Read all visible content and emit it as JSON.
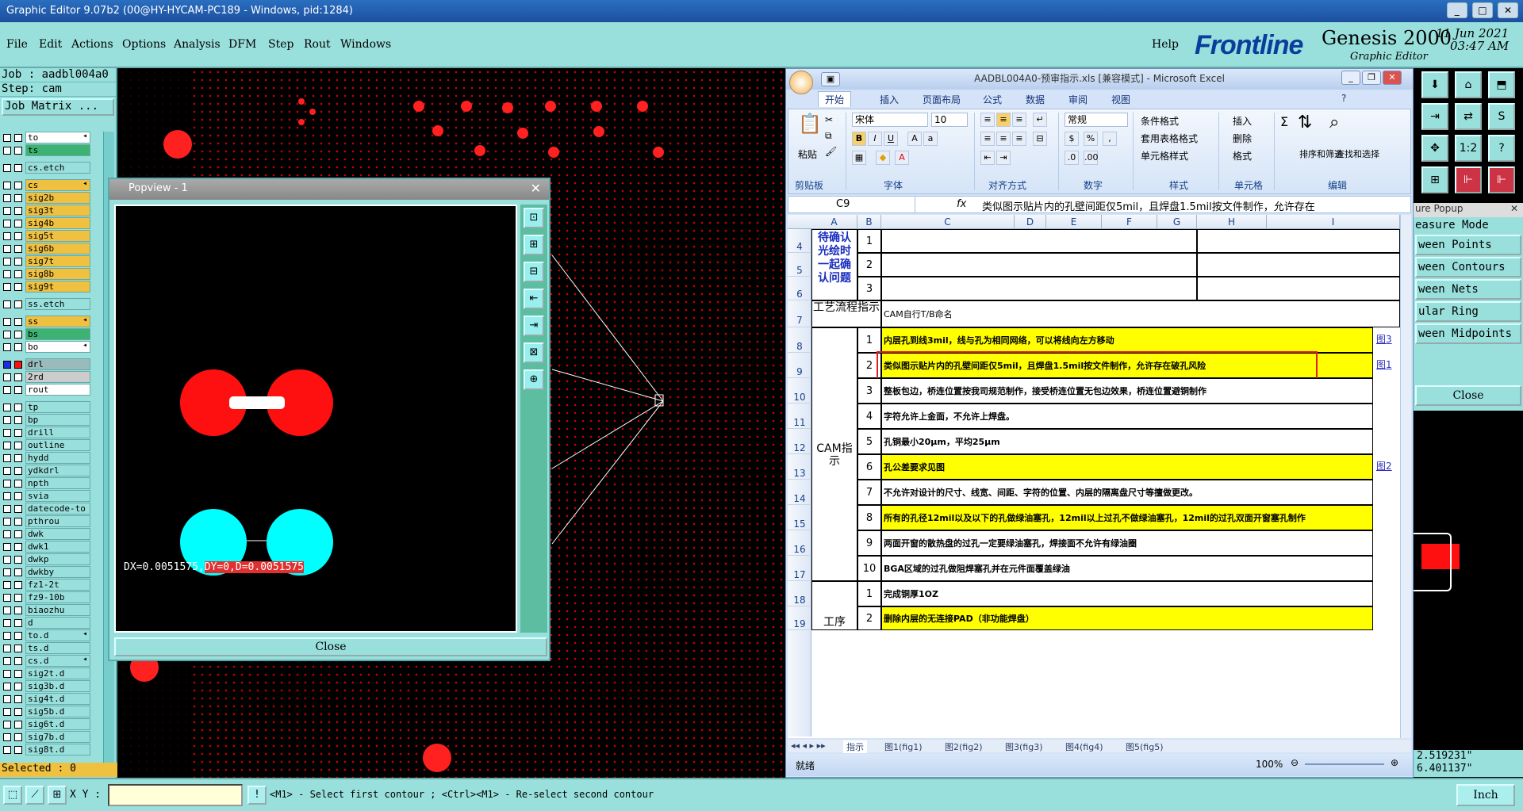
{
  "window": {
    "title": "Graphic Editor 9.07b2 (00@HY-HYCAM-PC189 - Windows, pid:1284)"
  },
  "menu": {
    "items": [
      "File",
      "Edit",
      "Actions",
      "Options",
      "Analysis",
      "DFM",
      "Step",
      "Rout",
      "Windows"
    ],
    "help": "Help"
  },
  "brand": {
    "logo": "Frontline",
    "product": "Genesis 2000",
    "subtitle": "Graphic Editor",
    "date": "11 Jun 2021",
    "time": "03:47 AM"
  },
  "job": {
    "job": "Job : aadbl004a0",
    "step": "Step: cam",
    "matrix": "Job Matrix ...",
    "selected": "Selected : 0"
  },
  "layers": [
    {
      "name": "to",
      "color": "#ffffff",
      "arrow": true
    },
    {
      "name": "ts",
      "color": "#3cb371"
    },
    "gap",
    {
      "name": "cs.etch",
      "color": "#99e0dc"
    },
    "gap",
    {
      "name": "cs",
      "color": "#f0c040",
      "arrow": true
    },
    {
      "name": "sig2b",
      "color": "#f0c040"
    },
    {
      "name": "sig3t",
      "color": "#f0c040"
    },
    {
      "name": "sig4b",
      "color": "#f0c040"
    },
    {
      "name": "sig5t",
      "color": "#f0c040"
    },
    {
      "name": "sig6b",
      "color": "#f0c040"
    },
    {
      "name": "sig7t",
      "color": "#f0c040"
    },
    {
      "name": "sig8b",
      "color": "#f0c040"
    },
    {
      "name": "sig9t",
      "color": "#f0c040"
    },
    "gap",
    {
      "name": "ss.etch",
      "color": "#99e0dc"
    },
    "gap",
    {
      "name": "ss",
      "color": "#f0c040",
      "arrow": true
    },
    {
      "name": "bs",
      "color": "#3cb371"
    },
    {
      "name": "bo",
      "color": "#ffffff",
      "arrow": true
    },
    "gap",
    {
      "name": "drl",
      "color": "#99bbbb",
      "active": true
    },
    {
      "name": "2rd",
      "color": "#cccccc"
    },
    {
      "name": "rout",
      "color": "#ffffff"
    },
    "gap",
    {
      "name": "tp",
      "color": "#99e0dc"
    },
    {
      "name": "bp",
      "color": "#99e0dc"
    },
    {
      "name": "drill",
      "color": "#99e0dc"
    },
    {
      "name": "outline",
      "color": "#99e0dc"
    },
    {
      "name": "hydd",
      "color": "#99e0dc"
    },
    {
      "name": "ydkdrl",
      "color": "#99e0dc"
    },
    {
      "name": "npth",
      "color": "#99e0dc"
    },
    {
      "name": "svia",
      "color": "#99e0dc"
    },
    {
      "name": "datecode-to",
      "color": "#99e0dc"
    },
    {
      "name": "pthrou",
      "color": "#99e0dc"
    },
    {
      "name": "dwk",
      "color": "#99e0dc"
    },
    {
      "name": "dwk1",
      "color": "#99e0dc"
    },
    {
      "name": "dwkp",
      "color": "#99e0dc"
    },
    {
      "name": "dwkby",
      "color": "#99e0dc"
    },
    {
      "name": "fz1-2t",
      "color": "#99e0dc"
    },
    {
      "name": "fz9-10b",
      "color": "#99e0dc"
    },
    {
      "name": "biaozhu",
      "color": "#99e0dc"
    },
    {
      "name": "d",
      "color": "#99e0dc"
    },
    {
      "name": "to.d",
      "color": "#99e0dc",
      "arrow": true
    },
    {
      "name": "ts.d",
      "color": "#99e0dc"
    },
    {
      "name": "cs.d",
      "color": "#99e0dc",
      "arrow": true
    },
    {
      "name": "sig2t.d",
      "color": "#99e0dc"
    },
    {
      "name": "sig3b.d",
      "color": "#99e0dc"
    },
    {
      "name": "sig4t.d",
      "color": "#99e0dc"
    },
    {
      "name": "sig5b.d",
      "color": "#99e0dc"
    },
    {
      "name": "sig6t.d",
      "color": "#99e0dc"
    },
    {
      "name": "sig7b.d",
      "color": "#99e0dc"
    },
    {
      "name": "sig8t.d",
      "color": "#99e0dc"
    }
  ],
  "popview": {
    "title": "Popview - 1",
    "measure_a": "DX=0.0051575,",
    "measure_b": "DY=0,D=0.0051575",
    "close": "Close"
  },
  "bottom": {
    "xy_label": "X Y :",
    "xy_value": "",
    "prompt": "<M1> - Select first contour ; <Ctrl><M1> - Re-select second contour",
    "units": "Inch"
  },
  "measure_popup": {
    "title": "ure Popup",
    "mode": "easure Mode",
    "items": [
      "ween Points",
      "ween Contours",
      "ween Nets",
      "ular Ring",
      "ween Midpoints"
    ],
    "close": "Close",
    "coord1": "2.519231\"",
    "coord2": "6.401137\""
  },
  "excel": {
    "title": "AADBL004A0-预审指示.xls [兼容模式] - Microsoft Excel",
    "tabs": [
      "开始",
      "插入",
      "页面布局",
      "公式",
      "数据",
      "审阅",
      "视图"
    ],
    "ribbon": {
      "paste": "粘贴",
      "clipboard": "剪贴板",
      "font_name": "宋体",
      "font_size": "10",
      "font": "字体",
      "align": "对齐方式",
      "num_fmt": "常规",
      "number": "数字",
      "cond_fmt": "条件格式",
      "table_fmt": "套用表格格式",
      "cell_style": "单元格样式",
      "style": "样式",
      "insert": "插入",
      "delete": "删除",
      "format": "格式",
      "cells": "单元格",
      "sort": "排序和筛选",
      "find": "查找和选择",
      "edit": "编辑",
      "bold": "B",
      "italic": "I",
      "underline": "U",
      "pct": "%"
    },
    "namebox": "C9",
    "formula": "类似图示贴片内的孔壁间距仅5mil，且焊盘1.5mil按文件制作，允许存在",
    "columns": [
      "A",
      "B",
      "C",
      "D",
      "E",
      "F",
      "G",
      "H",
      "I"
    ],
    "rows": [
      "4",
      "5",
      "6",
      "7",
      "8",
      "9",
      "10",
      "11",
      "12",
      "13",
      "14",
      "15",
      "16",
      "17",
      "18",
      "19"
    ],
    "pending": "待确认光绘时一起确认问题",
    "flow": "工艺流程指示",
    "flow_text": "CAM自行T/B命名",
    "cam": "CAM指示",
    "proc": "工序",
    "items": [
      {
        "n": "1",
        "text": "内层孔到线3mil，线与孔为相同网络，可以将线向左方移动",
        "y": true,
        "link": "图3"
      },
      {
        "n": "2",
        "text": "类似图示贴片内的孔壁间距仅5mil，且焊盘1.5mil按文件制作，允许存在破孔风险",
        "y": true,
        "link": "图1"
      },
      {
        "n": "3",
        "text": "整板包边，桥连位置按我司规范制作，接受桥连位置无包边效果，桥连位置避铜制作",
        "y": false
      },
      {
        "n": "4",
        "text": "字符允许上金面，不允许上焊盘。",
        "y": false
      },
      {
        "n": "5",
        "text": "孔铜最小20μm，平均25μm",
        "y": false
      },
      {
        "n": "6",
        "text": "孔公差要求见图",
        "y": true,
        "link": "图2"
      },
      {
        "n": "7",
        "text": "不允许对设计的尺寸、线宽、间距、字符的位置、内层的隔离盘尺寸等擅做更改。",
        "y": false
      },
      {
        "n": "8",
        "text": "所有的孔径12mil以及以下的孔做绿油塞孔，12mil以上过孔不做绿油塞孔，12mil的过孔双面开窗塞孔制作",
        "y": true
      },
      {
        "n": "9",
        "text": "两面开窗的散热盘的过孔一定要绿油塞孔，焊接面不允许有绿油圈",
        "y": false
      },
      {
        "n": "10",
        "text": "BGA区域的过孔做阻焊塞孔并在元件面覆盖绿油",
        "y": false
      }
    ],
    "proc_items": [
      {
        "n": "1",
        "text": "完成铜厚1OZ",
        "y": false
      },
      {
        "n": "2",
        "text": "删除内层的无连接PAD（非功能焊盘）",
        "y": true
      }
    ],
    "sheet_tabs": [
      "指示",
      "图1(fig1)",
      "图2(fig2)",
      "图3(fig3)",
      "图4(fig4)",
      "图5(fig5)"
    ],
    "status": "就绪",
    "zoom": "100%"
  }
}
